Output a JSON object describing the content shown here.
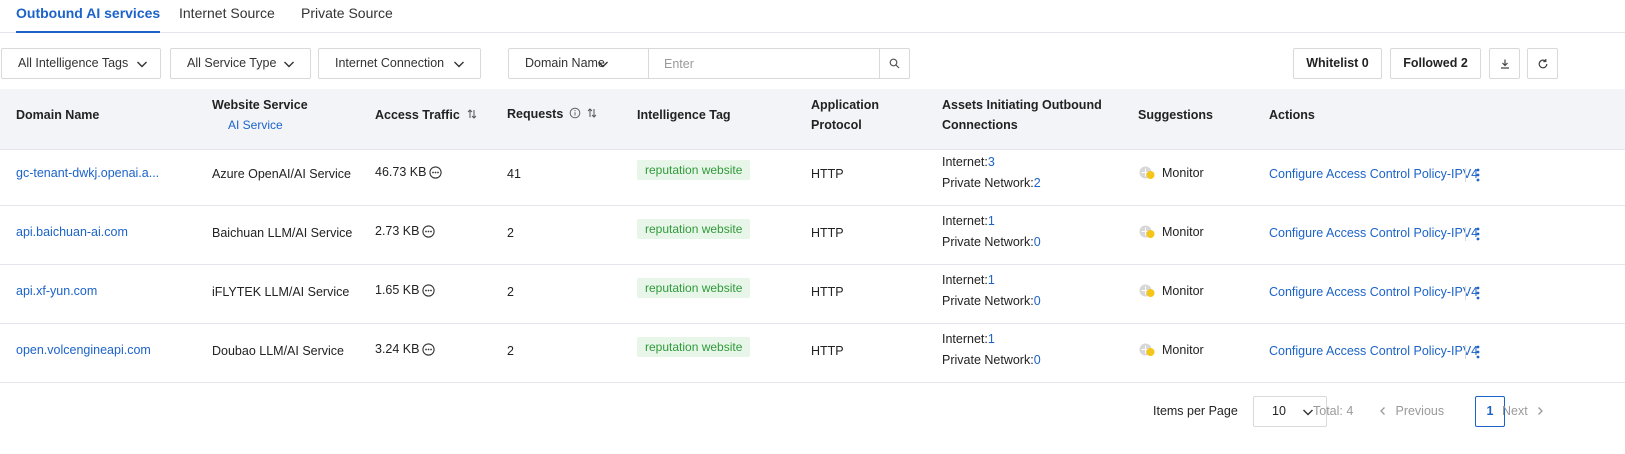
{
  "tabs": [
    {
      "label": "Outbound AI services",
      "active": true
    },
    {
      "label": "Internet Source",
      "active": false
    },
    {
      "label": "Private Source",
      "active": false
    }
  ],
  "filters": {
    "intelligence_tags": "All Intelligence Tags",
    "service_type": "All Service Type",
    "connection": "Internet Connection",
    "search_field": "Domain Name",
    "search_placeholder": "Enter",
    "whitelist": "Whitelist 0",
    "followed": "Followed 2"
  },
  "table": {
    "headers": {
      "domain": "Domain Name",
      "website_service": "Website Service",
      "website_service_sub": "AI Service",
      "access_traffic": "Access Traffic",
      "requests": "Requests",
      "intelligence_tag": "Intelligence Tag",
      "protocol_line1": "Application",
      "protocol_line2": "Protocol",
      "assets_line1": "Assets Initiating Outbound",
      "assets_line2": "Connections",
      "suggestions": "Suggestions",
      "actions": "Actions"
    },
    "rows": [
      {
        "domain": "gc-tenant-dwkj.openai.a...",
        "service": "Azure OpenAI/AI Service",
        "traffic": "46.73 KB",
        "requests": "41",
        "tag": "reputation website",
        "protocol": "HTTP",
        "internet_label": "Internet:",
        "internet": "3",
        "private_label": "Private Network:",
        "private": "2",
        "suggestion": "Monitor",
        "action": "Configure Access Control Policy-IPV4"
      },
      {
        "domain": "api.baichuan-ai.com",
        "service": "Baichuan LLM/AI Service",
        "traffic": "2.73 KB",
        "requests": "2",
        "tag": "reputation website",
        "protocol": "HTTP",
        "internet_label": "Internet:",
        "internet": "1",
        "private_label": "Private Network:",
        "private": "0",
        "suggestion": "Monitor",
        "action": "Configure Access Control Policy-IPV4"
      },
      {
        "domain": "api.xf-yun.com",
        "service": "iFLYTEK LLM/AI Service",
        "traffic": "1.65 KB",
        "requests": "2",
        "tag": "reputation website",
        "protocol": "HTTP",
        "internet_label": "Internet:",
        "internet": "1",
        "private_label": "Private Network:",
        "private": "0",
        "suggestion": "Monitor",
        "action": "Configure Access Control Policy-IPV4"
      },
      {
        "domain": "open.volcengineapi.com",
        "service": "Doubao LLM/AI Service",
        "traffic": "3.24 KB",
        "requests": "2",
        "tag": "reputation website",
        "protocol": "HTTP",
        "internet_label": "Internet:",
        "internet": "1",
        "private_label": "Private Network:",
        "private": "0",
        "suggestion": "Monitor",
        "action": "Configure Access Control Policy-IPV4"
      }
    ]
  },
  "pagination": {
    "items_per_page_label": "Items per Page",
    "items_per_page": "10",
    "total": "Total: 4",
    "previous": "Previous",
    "current_page": "1",
    "next": "Next"
  },
  "colors": {
    "accent": "#1c63c9",
    "tag_bg": "#e8f6e9",
    "tag_text": "#2f9a3a",
    "header_bg": "#f2f4f8"
  },
  "icons": [
    "chevron-down-icon",
    "search-icon",
    "download-icon",
    "refresh-icon",
    "info-icon",
    "sort-icon",
    "more-circle-icon",
    "monitor-status-icon",
    "more-vertical-icon",
    "chevron-left-icon",
    "chevron-right-icon"
  ]
}
